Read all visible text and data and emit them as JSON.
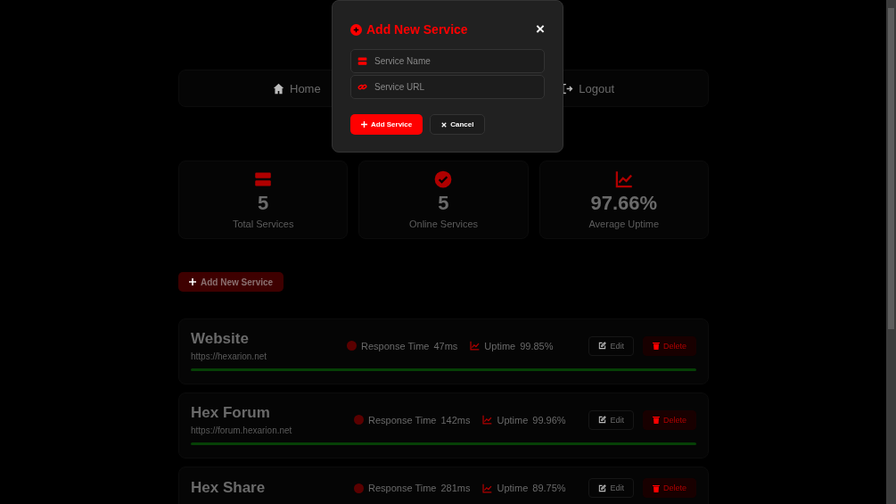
{
  "nav": {
    "items": [
      {
        "kind": "home",
        "label": "Home"
      },
      {
        "kind": "logout",
        "label": "Logout"
      }
    ]
  },
  "stats": [
    {
      "kind": "servers",
      "value": "5",
      "label": "Total Services"
    },
    {
      "kind": "check",
      "value": "5",
      "label": "Online Services"
    },
    {
      "kind": "chart",
      "value": "97.66%",
      "label": "Average Uptime"
    }
  ],
  "add_button": {
    "label": "Add New Service"
  },
  "services": [
    {
      "name": "Website",
      "url": "https://hexarion.net",
      "response_label": "Response Time",
      "response": "47ms",
      "uptime_label": "Uptime",
      "uptime": "99.85%",
      "edit": "Edit",
      "delete": "Delete"
    },
    {
      "name": "Hex Forum",
      "url": "https://forum.hexarion.net",
      "response_label": "Response Time",
      "response": "142ms",
      "uptime_label": "Uptime",
      "uptime": "99.96%",
      "edit": "Edit",
      "delete": "Delete"
    },
    {
      "name": "Hex Share",
      "response_label": "Response Time",
      "response": "281ms",
      "uptime_label": "Uptime",
      "uptime": "89.75%",
      "edit": "Edit",
      "delete": "Delete"
    }
  ],
  "modal": {
    "title": "Add New Service",
    "close": "×",
    "fields": [
      {
        "kind": "name",
        "placeholder": "Service Name"
      },
      {
        "kind": "url",
        "placeholder": "Service URL"
      }
    ],
    "submit": "Add Service",
    "cancel": "Cancel"
  }
}
